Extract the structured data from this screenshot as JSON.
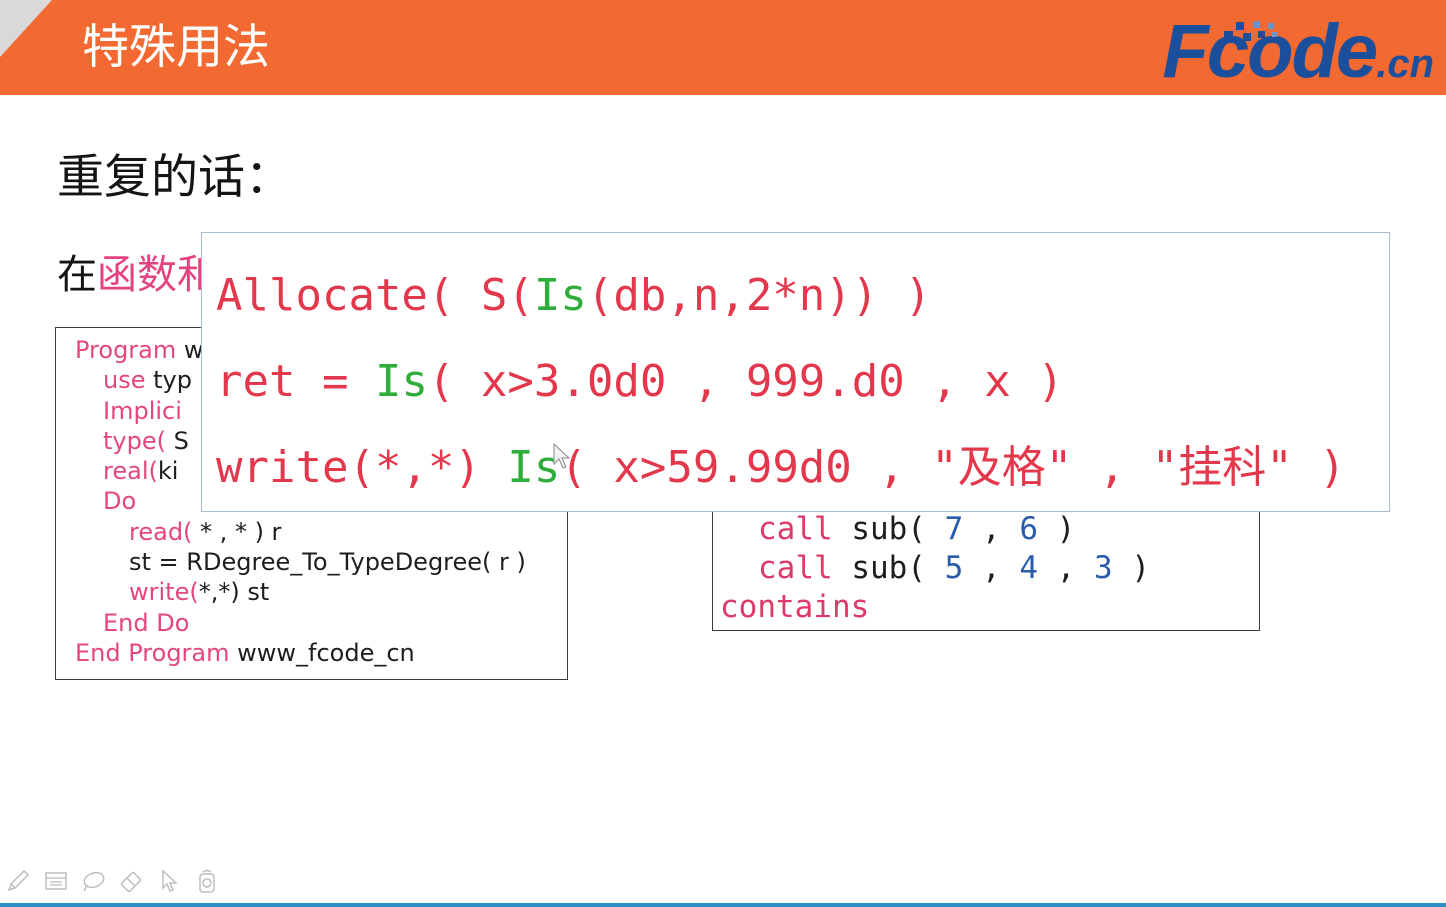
{
  "header": {
    "title": "特殊用法",
    "logo_main": "Fcode",
    "logo_suffix": ".cn"
  },
  "slide": {
    "heading": "重复的话：",
    "intro_plain": "在",
    "intro_highlight": "函数和"
  },
  "left_code": {
    "lines": [
      [
        "Program",
        " w"
      ],
      [
        "use",
        " typ"
      ],
      [
        "Implici"
      ],
      [
        "type(",
        " S"
      ],
      [
        "real(",
        "ki"
      ],
      [
        "Do"
      ],
      [
        "read(",
        " * , * ) r"
      ],
      [
        "st = RDegree_To_TypeDegree( r )"
      ],
      [
        "write(",
        "*,*) st"
      ],
      [
        "End Do"
      ],
      [
        "End Program",
        " www_fcode_cn"
      ]
    ]
  },
  "right_code": {
    "lines": [
      [
        "call",
        " sub( ",
        "7",
        " , ",
        "6",
        " )"
      ],
      [
        "call",
        " sub( ",
        "5",
        " , ",
        "4",
        " , ",
        "3",
        " )"
      ],
      [
        "contains"
      ]
    ]
  },
  "popup": {
    "lines": [
      [
        "Allocate( S(",
        "Is",
        "(db,n,2*n)) )"
      ],
      [
        "ret = ",
        "Is",
        "( x>3.0d0 , 999.d0 , x )"
      ],
      [
        "write(*,*) ",
        "Is",
        "( x>59.99d0 , \"及格\" , \"挂科\" )"
      ]
    ]
  },
  "toolbar": {
    "icons": [
      "pen-icon",
      "slide-sorter-icon",
      "lasso-icon",
      "eraser-icon",
      "pointer-icon",
      "recorder-icon"
    ]
  },
  "colors": {
    "header_bg": "#f26a32",
    "corner": "#d9d9d9",
    "logo": "#1b4f9c",
    "intro_highlight": "#e4437f",
    "code_keyword": "#e4467f",
    "call_keyword": "#dd3a6a",
    "number": "#2b5cab",
    "popup_text": "#e3374c",
    "popup_function": "#2fad3b",
    "bottom_line": "#2a8fc6"
  }
}
